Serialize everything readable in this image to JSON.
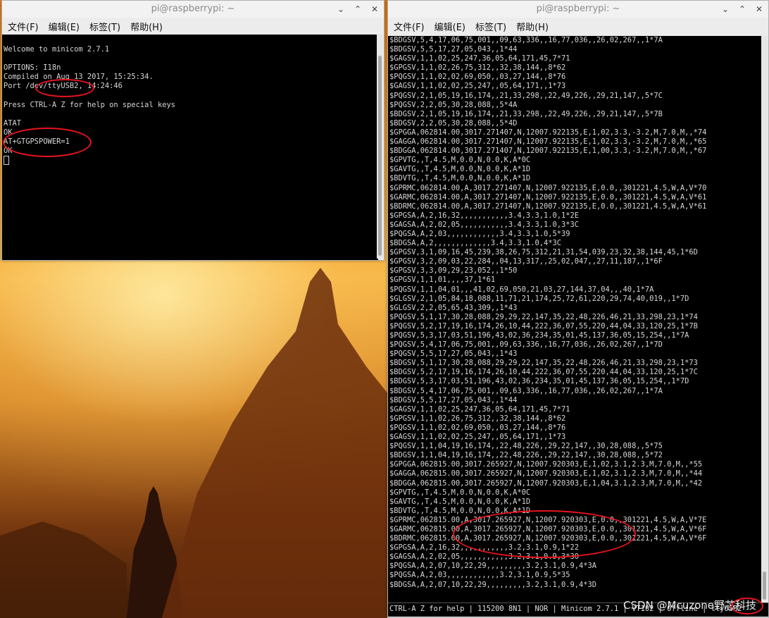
{
  "left_window": {
    "title": "pi@raspberrypi: ~",
    "menu": [
      "文件(F)",
      "编辑(E)",
      "标签(T)",
      "帮助(H)"
    ],
    "controls": [
      "⌄",
      "⌃",
      "✕"
    ],
    "lines": [
      "",
      "Welcome to minicom 2.7.1",
      "",
      "OPTIONS: I18n",
      "Compiled on Aug 13 2017, 15:25:34.",
      "Port /dev/ttyUSB2, 14:24:46",
      "",
      "Press CTRL-A Z for help on special keys",
      "",
      "ATAT",
      "OK",
      "AT+GTGPSPOWER=1",
      "OK"
    ]
  },
  "right_window": {
    "title": "pi@raspberrypi: ~",
    "menu": [
      "文件(F)",
      "编辑(E)",
      "标签(T)",
      "帮助(H)"
    ],
    "controls": [
      "⌄",
      "⌃",
      "✕"
    ],
    "lines": [
      "$BDGSV,5,4,17,06,75,001,,09,63,336,,16,77,036,,26,02,267,,1*7A",
      "$BDGSV,5,5,17,27,05,043,,1*44",
      "$GAGSV,1,1,02,25,247,36,05,64,171,45,7*71",
      "$GPGSV,1,1,02,26,75,312,,32,38,144,,8*62",
      "$PQGSV,1,1,02,02,69,050,,03,27,144,,8*76",
      "$GAGSV,1,1,02,02,25,247,,05,64,171,,1*73",
      "$PQGSV,2,1,05,19,16,174,,21,33,298,,22,49,226,,29,21,147,,5*7C",
      "$PQGSV,2,2,05,30,28,088,,5*4A",
      "$BDGSV,2,1,05,19,16,174,,21,33,298,,22,49,226,,29,21,147,,5*7B",
      "$BDGSV,2,2,05,30,28,088,,5*4D",
      "$GPGGA,062814.00,3017.271407,N,12007.922135,E,1,02,3.3,-3.2,M,7.0,M,,*74",
      "$GAGGA,062814.00,3017.271407,N,12007.922135,E,1,02,3.3,-3.2,M,7.0,M,,*65",
      "$BDGGA,062814.00,3017.271407,N,12007.922135,E,1,00,3.3,-3.2,M,7.0,M,,*67",
      "$GPVTG,,T,4.5,M,0.0,N,0.0,K,A*0C",
      "$GAVTG,,T,4.5,M,0.0,N,0.0,K,A*1D",
      "$BDVTG,,T,4.5,M,0.0,N,0.0,K,A*1D",
      "$GPRMC,062814.00,A,3017.271407,N,12007.922135,E,0.0,,301221,4.5,W,A,V*70",
      "$GARMC,062814.00,A,3017.271407,N,12007.922135,E,0.0,,301221,4.5,W,A,V*61",
      "$BDRMC,062814.00,A,3017.271407,N,12007.922135,E,0.0,,301221,4.5,W,A,V*61",
      "$GPGSA,A,2,16,32,,,,,,,,,,,3.4,3.3,1.0,1*2E",
      "$GAGSA,A,2,02,05,,,,,,,,,,,3.4,3.3,1.0,3*3C",
      "$PQGSA,A,2,03,,,,,,,,,,,,3.4,3.3,1.0,5*39",
      "$BDGSA,A,2,,,,,,,,,,,,,3.4,3.3,1.0,4*3C",
      "$GPGSV,3,1,09,16,45,239,38,26,75,312,21,31,54,039,23,32,38,144,45,1*6D",
      "$GPGSV,3,2,09,03,22,284,,04,13,317,,25,02,047,,27,11,187,,1*6F",
      "$GPGSV,3,3,09,29,23,052,,1*50",
      "$GPGSV,1,1,01,,,,37,1*61",
      "$PQGSV,1,1,04,01,,,41,02,69,050,21,03,27,144,37,04,,,40,1*7A",
      "$GLGSV,2,1,05,84,18,088,11,71,21,174,25,72,61,220,29,74,40,019,,1*7D",
      "$GLGSV,2,2,05,65,43,309,,1*43",
      "$PQGSV,5,1,17,30,28,088,29,29,22,147,35,22,48,226,46,21,33,298,23,1*74",
      "$PQGSV,5,2,17,19,16,174,26,10,44,222,36,07,55,220,44,04,33,120,25,1*7B",
      "$PQGSV,5,3,17,03,51,196,43,02,36,234,35,01,45,137,36,05,15,254,,1*7A",
      "$PQGSV,5,4,17,06,75,001,,09,63,336,,16,77,036,,26,02,267,,1*7D",
      "$PQGSV,5,5,17,27,05,043,,1*43",
      "$BDGSV,5,1,17,30,28,088,29,29,22,147,35,22,48,226,46,21,33,298,23,1*73",
      "$BDGSV,5,2,17,19,16,174,26,10,44,222,36,07,55,220,44,04,33,120,25,1*7C",
      "$BDGSV,5,3,17,03,51,196,43,02,36,234,35,01,45,137,36,05,15,254,,1*7D",
      "$BDGSV,5,4,17,06,75,001,,09,63,336,,16,77,036,,26,02,267,,1*7A",
      "$BDGSV,5,5,17,27,05,043,,1*44",
      "$GAGSV,1,1,02,25,247,36,05,64,171,45,7*71",
      "$GPGSV,1,1,02,26,75,312,,32,38,144,,8*62",
      "$PQGSV,1,1,02,02,69,050,,03,27,144,,8*76",
      "$GAGSV,1,1,02,02,25,247,,05,64,171,,1*73",
      "$PQGSV,1,1,04,19,16,174,,22,48,226,,29,22,147,,30,28,088,,5*75",
      "$BDGSV,1,1,04,19,16,174,,22,48,226,,29,22,147,,30,28,088,,5*72",
      "$GPGGA,062815.00,3017.265927,N,12007.920303,E,1,02,3.1,2.3,M,7.0,M,,*55",
      "$GAGGA,062815.00,3017.265927,N,12007.920303,E,1,02,3.1,2.3,M,7.0,M,,*44",
      "$BDGGA,062815.00,3017.265927,N,12007.920303,E,1,04,3.1,2.3,M,7.0,M,,*42",
      "$GPVTG,,T,4.5,M,0.0,N,0.0,K,A*0C",
      "$GAVTG,,T,4.5,M,0.0,N,0.0,K,A*1D",
      "$BDVTG,,T,4.5,M,0.0,N,0.0,K,A*1D",
      "$GPRMC,062815.00,A,3017.265927,N,12007.920303,E,0.0,,301221,4.5,W,A,V*7E",
      "$GARMC,062815.00,A,3017.265927,N,12007.920303,E,0.0,,301221,4.5,W,A,V*6F",
      "$BDRMC,062815.00,A,3017.265927,N,12007.920303,E,0.0,,301221,4.5,W,A,V*6F",
      "$GPGSA,A,2,16,32,,,,,,,,,,,3.2,3.1,0.9,1*22",
      "$GAGSA,A,2,02,05,,,,,,,,,,,3.2,3.1,0.9,3*30",
      "$PQGSA,A,2,07,10,22,29,,,,,,,,,3.2,3.1,0.9,4*3A",
      "$PQGSA,A,2,03,,,,,,,,,,,,3.2,3.1,0.9,5*35",
      "$BDGSA,A,2,07,10,22,29,,,,,,,,,3.2,3.1,0.9,4*3D"
    ],
    "status": "CTRL-A Z for help | 115200 8N1 | NOR | Minicom 2.7.1 | VT102 | Offline | ttyUSB2"
  },
  "watermark": "CSDN @Mcuzone野芯科技",
  "colors": {
    "terminal_bg": "#000000",
    "terminal_fg": "#d6d6d6",
    "annotation": "#e8141c"
  }
}
